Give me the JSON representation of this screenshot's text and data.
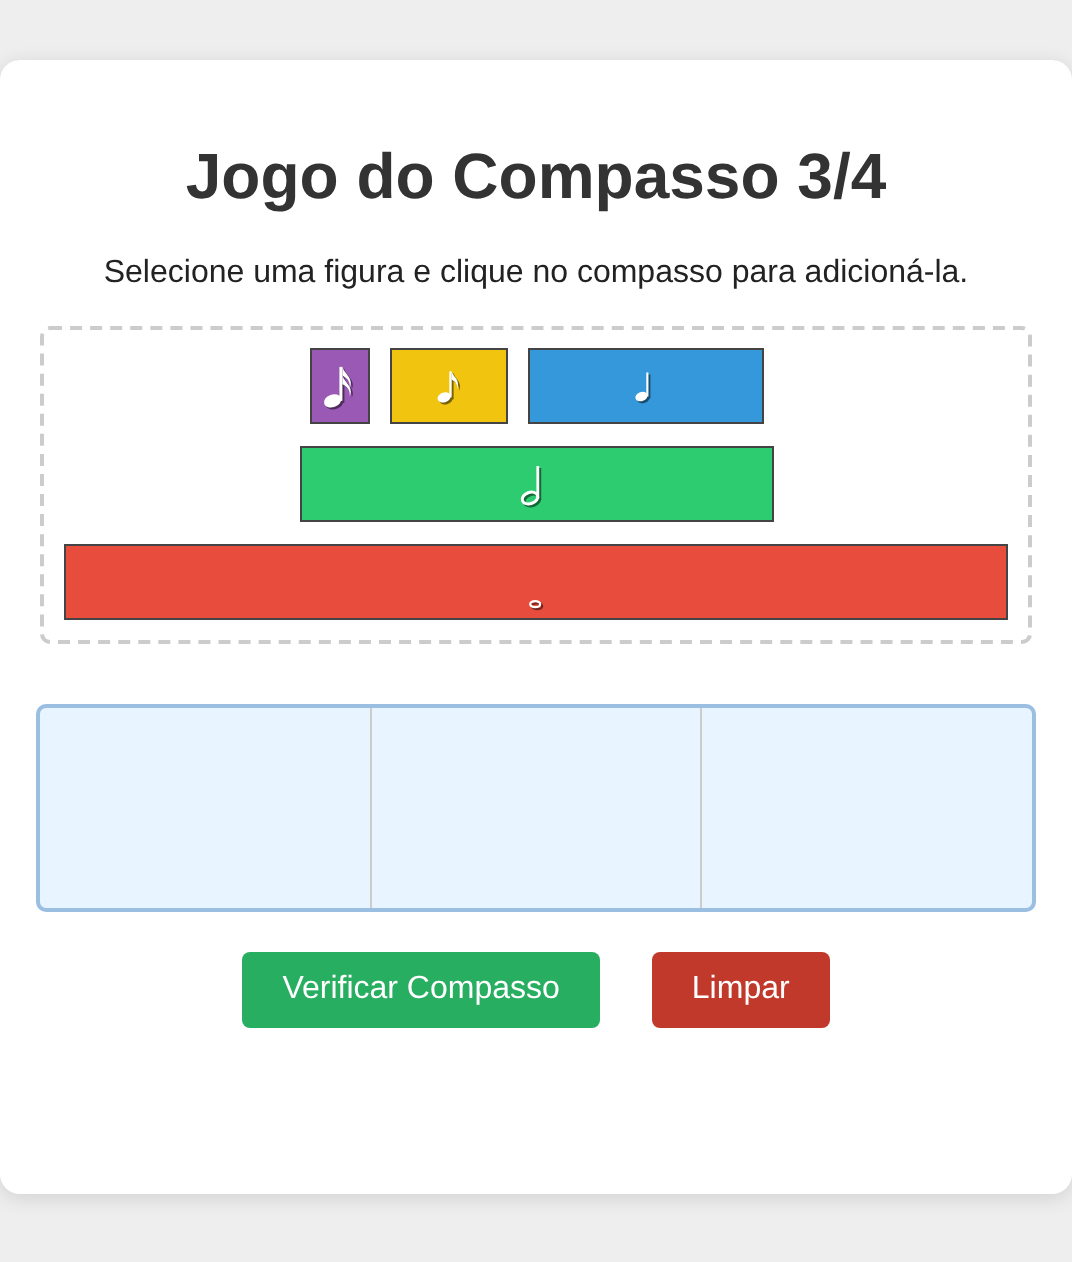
{
  "title": "Jogo do Compasso 3/4",
  "instruction": "Selecione uma figura e clique no compasso para adicioná-la.",
  "figures": [
    {
      "kind": "sixteenth",
      "color": "#9b59b6"
    },
    {
      "kind": "eighth",
      "color": "#f1c40f"
    },
    {
      "kind": "quarter",
      "color": "#3498db"
    },
    {
      "kind": "half",
      "color": "#2ecc71"
    },
    {
      "kind": "whole",
      "color": "#e74c3c"
    }
  ],
  "buttons": [
    {
      "label": "Verificar Compasso",
      "kind": "check"
    },
    {
      "label": "Limpar",
      "kind": "clear"
    }
  ]
}
